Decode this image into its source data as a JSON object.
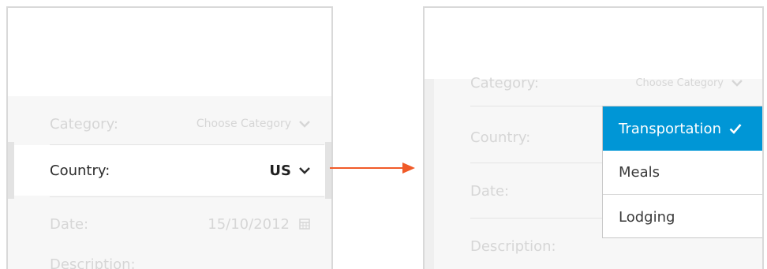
{
  "left_form": {
    "category": {
      "label": "Category:",
      "placeholder": "Choose Category"
    },
    "country": {
      "label": "Country:",
      "value": "US"
    },
    "date": {
      "label": "Date:",
      "value": "15/10/2012"
    },
    "description": {
      "label": "Description:"
    }
  },
  "right_form": {
    "category": {
      "label": "Category:",
      "placeholder": "Choose Category"
    },
    "country": {
      "label": "Country:"
    },
    "date": {
      "label": "Date:"
    },
    "description": {
      "label": "Description:"
    }
  },
  "dropdown": {
    "selected": "Transportation",
    "options": [
      "Transportation",
      "Meals",
      "Lodging"
    ]
  },
  "colors": {
    "accent": "#0096d6",
    "arrow": "#f05a28",
    "faded_text": "#d6d6d6",
    "active_text": "#2b2b2b"
  },
  "icons": [
    "chevron-down-icon",
    "calendar-icon",
    "checkmark-icon",
    "arrow-right-icon"
  ]
}
